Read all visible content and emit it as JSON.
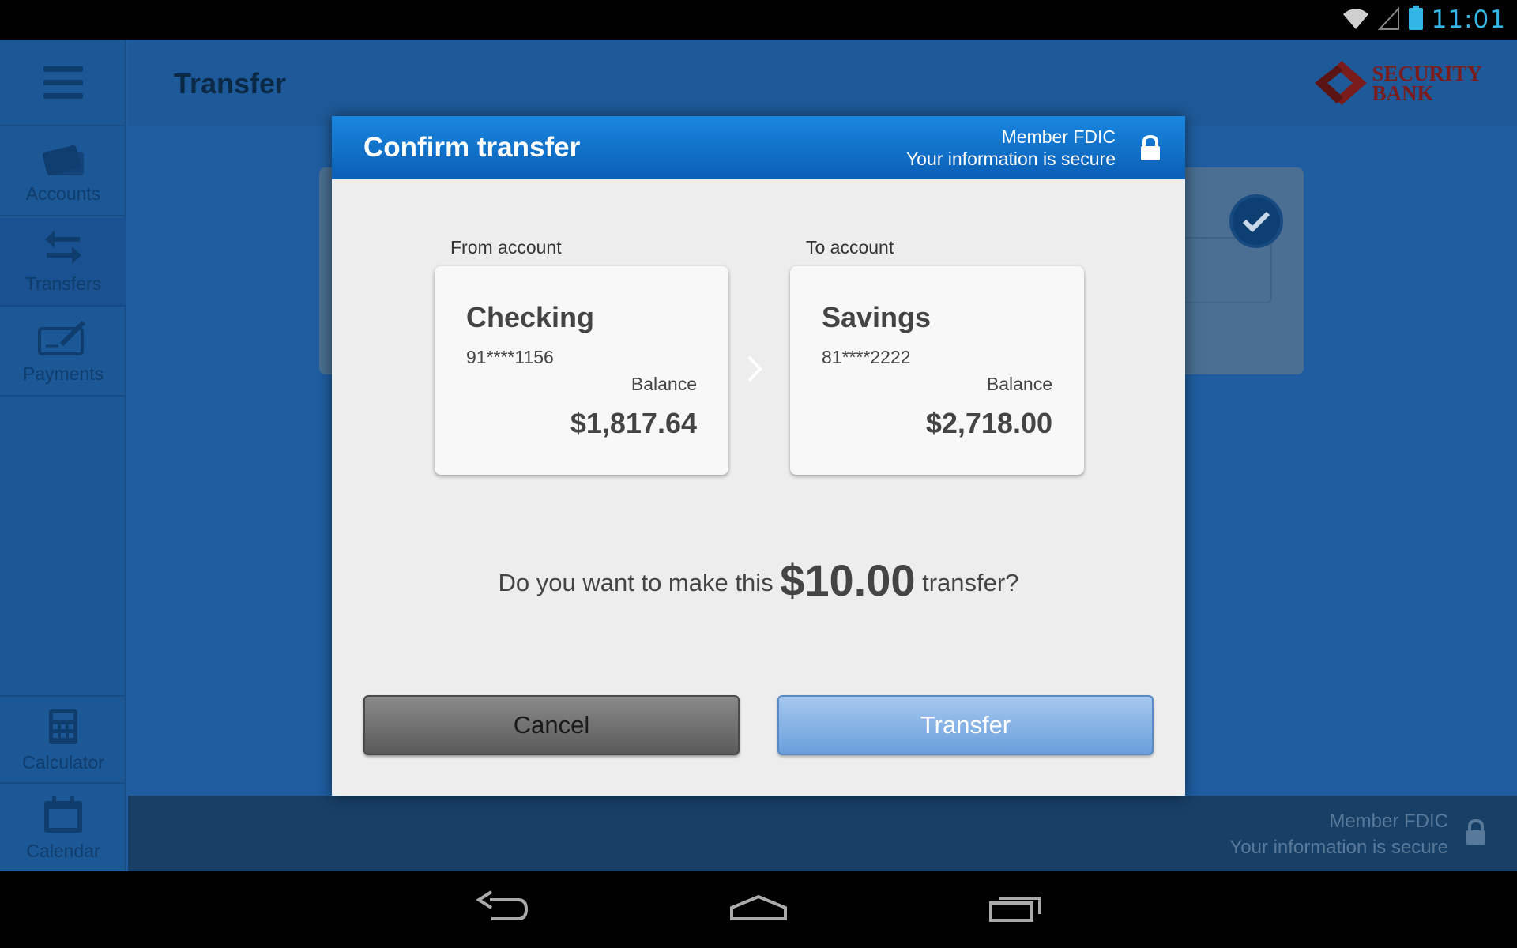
{
  "status_bar": {
    "time": "11:01",
    "icons": [
      "wifi-icon",
      "signal-icon",
      "battery-icon"
    ],
    "time_color": "#33b5e5"
  },
  "sidebar": {
    "items": [
      {
        "label": "Accounts",
        "icon": "cards-icon"
      },
      {
        "label": "Transfers",
        "icon": "transfer-arrows-icon"
      },
      {
        "label": "Payments",
        "icon": "checkbook-icon"
      },
      {
        "label": "Calculator",
        "icon": "calculator-icon"
      },
      {
        "label": "Calendar",
        "icon": "calendar-icon"
      }
    ],
    "active": "Transfers"
  },
  "header": {
    "title": "Transfer",
    "logo_line1": "SECURITY",
    "logo_line2": "BANK"
  },
  "footer": {
    "line1": "Member FDIC",
    "line2": "Your information is secure"
  },
  "dialog": {
    "title": "Confirm transfer",
    "secure_line1": "Member FDIC",
    "secure_line2": "Your information is secure",
    "from": {
      "label": "From account",
      "name": "Checking",
      "number": "91****1156",
      "balance_label": "Balance",
      "balance": "$1,817.64"
    },
    "to": {
      "label": "To account",
      "name": "Savings",
      "number": "81****2222",
      "balance_label": "Balance",
      "balance": "$2,718.00"
    },
    "question_prefix": "Do you want to make this",
    "amount": "$10.00",
    "question_suffix": "transfer?",
    "cancel_label": "Cancel",
    "transfer_label": "Transfer"
  },
  "colors": {
    "header_blue": "#0a5fb5",
    "app_bg": "#1f5da0",
    "brand_red": "#7a1c1c"
  }
}
